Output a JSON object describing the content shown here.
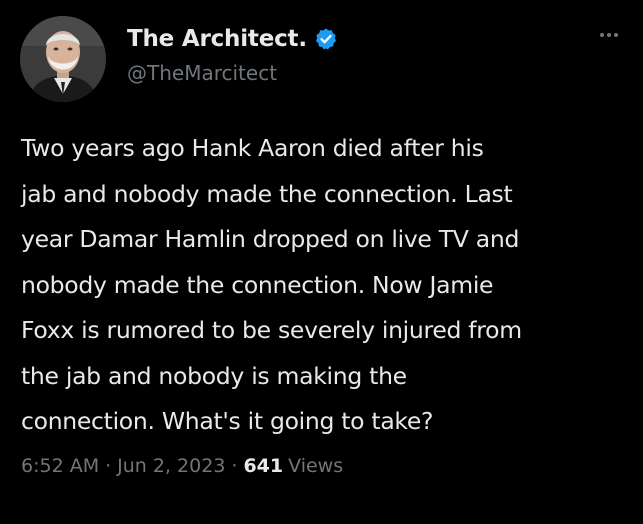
{
  "author": {
    "display_name": "The Architect.",
    "handle": "@TheMarcitect",
    "verified_badge_icon": "verified-check-icon",
    "avatar_icon": "profile-photo-avatar"
  },
  "more_menu_icon": "more-options-icon",
  "tweet": {
    "lines": [
      "Two years ago Hank Aaron died after his",
      "jab and nobody made the connection. Last",
      "year Damar Hamlin dropped on live TV and",
      "nobody made the connection. Now Jamie",
      "Foxx is rumored to be severely injured from",
      "the jab and nobody is making the",
      "connection. What's it going to take?"
    ]
  },
  "meta": {
    "time": "6:52 AM",
    "separator": "·",
    "date": "Jun 2, 2023",
    "views_count": "641",
    "views_label": "Views"
  },
  "colors": {
    "background": "#000000",
    "primary_text": "#e7e9ea",
    "secondary_text": "#71767b",
    "verified_blue": "#1d9bf0"
  }
}
